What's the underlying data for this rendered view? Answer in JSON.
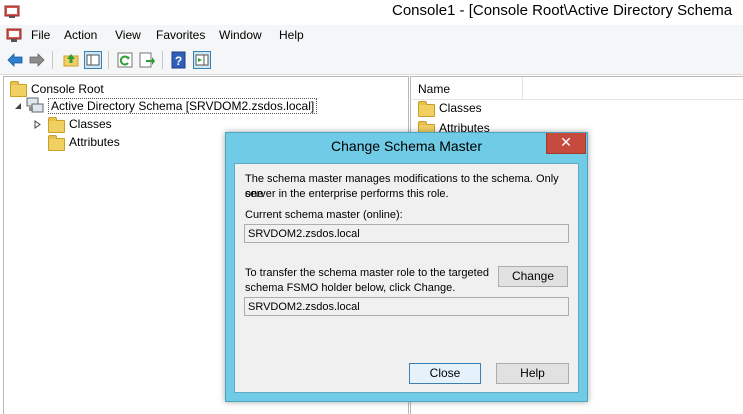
{
  "window": {
    "title": "Console1 - [Console Root\\Active Directory Schema"
  },
  "menu": [
    "File",
    "Action",
    "View",
    "Favorites",
    "Window",
    "Help"
  ],
  "toolbar": {
    "buttons": [
      "back-arrow-icon",
      "forward-arrow-icon",
      "up-folder-icon",
      "show-hide-tree-icon",
      "refresh-icon",
      "export-list-icon",
      "help-icon",
      "show-action-pane-icon"
    ]
  },
  "tree": {
    "root": "Console Root",
    "schema_node": "Active Directory Schema [SRVDOM2.zsdos.local]",
    "children": [
      "Classes",
      "Attributes"
    ]
  },
  "list": {
    "column_name": "Name",
    "items": [
      "Classes",
      "Attributes"
    ]
  },
  "dialog": {
    "title": "Change Schema Master",
    "close_glyph": "✕",
    "description_line1": "The schema master manages modifications to the schema. Only one",
    "description_line2": "server in the enterprise performs this role.",
    "current_label": "Current schema master (online):",
    "current_value": "SRVDOM2.zsdos.local",
    "transfer_line1": "To transfer the schema master role to the targeted",
    "transfer_line2": "schema FSMO holder below, click Change.",
    "change_label": "Change",
    "target_value": "SRVDOM2.zsdos.local",
    "close_label": "Close",
    "help_label": "Help"
  },
  "colors": {
    "dialog_frame": "#6fcbe6",
    "close_button": "#c74a3e",
    "folder": "#f0cf63"
  }
}
